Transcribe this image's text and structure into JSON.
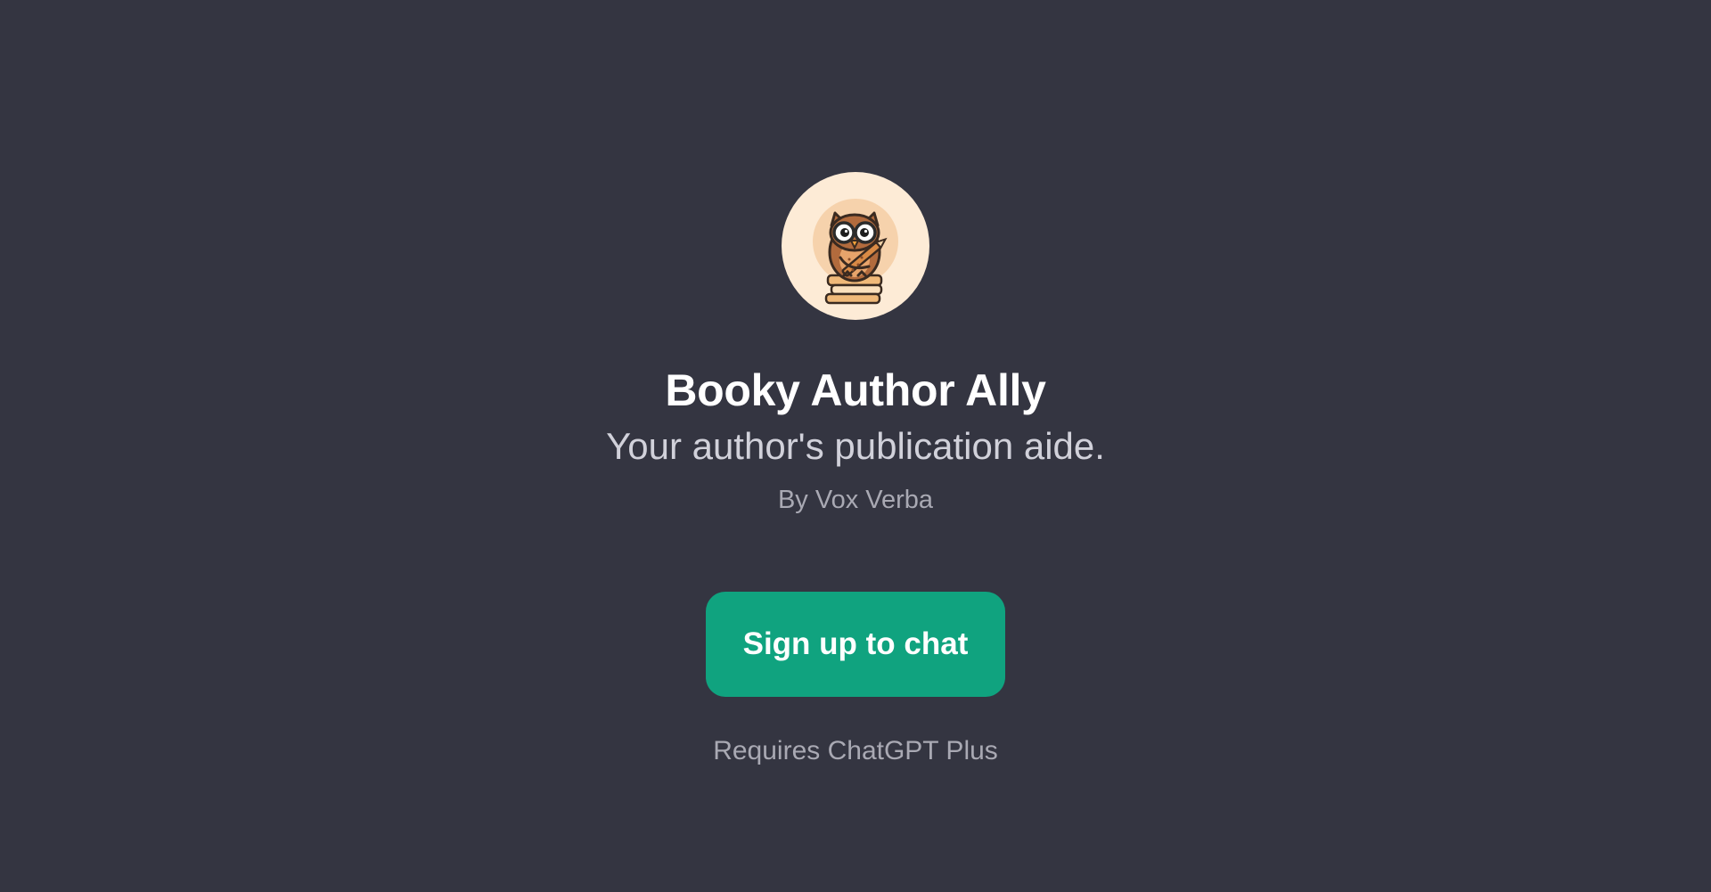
{
  "gpt": {
    "title": "Booky Author Ally",
    "subtitle": "Your author's publication aide.",
    "author_line": "By Vox Verba",
    "avatar_icon": "owl-on-books-icon"
  },
  "cta": {
    "label": "Sign up to chat"
  },
  "requirement_text": "Requires ChatGPT Plus",
  "colors": {
    "background": "#343541",
    "accent": "#10a37f",
    "avatar_bg": "#fdebd6",
    "title": "#ffffff",
    "subtitle": "#d1d1da",
    "muted": "#a9a9b3"
  }
}
